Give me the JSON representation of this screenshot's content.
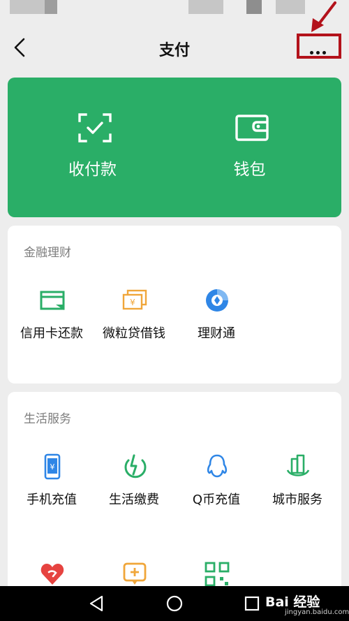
{
  "header": {
    "title": "支付"
  },
  "wallet_card": {
    "items": [
      {
        "label": "收付款",
        "icon": "scan-check-icon"
      },
      {
        "label": "钱包",
        "icon": "wallet-icon"
      }
    ]
  },
  "finance": {
    "title": "金融理财",
    "items": [
      {
        "label": "信用卡还款",
        "icon": "credit-card-icon"
      },
      {
        "label": "微粒贷借钱",
        "icon": "loan-icon"
      },
      {
        "label": "理财通",
        "icon": "wealth-icon"
      }
    ]
  },
  "life": {
    "title": "生活服务",
    "items": [
      {
        "label": "手机充值",
        "icon": "phone-topup-icon"
      },
      {
        "label": "生活缴费",
        "icon": "utilities-icon"
      },
      {
        "label": "Q币充值",
        "icon": "qq-icon"
      },
      {
        "label": "城市服务",
        "icon": "city-icon"
      }
    ],
    "partial_row_icons": [
      "heart-icon",
      "medical-icon",
      "qr-code-icon"
    ]
  },
  "watermark": {
    "brand": "Bai 经验",
    "url": "jingyan.baidu.com"
  },
  "colors": {
    "accent": "#2aae67",
    "annotation": "#b3121b"
  }
}
